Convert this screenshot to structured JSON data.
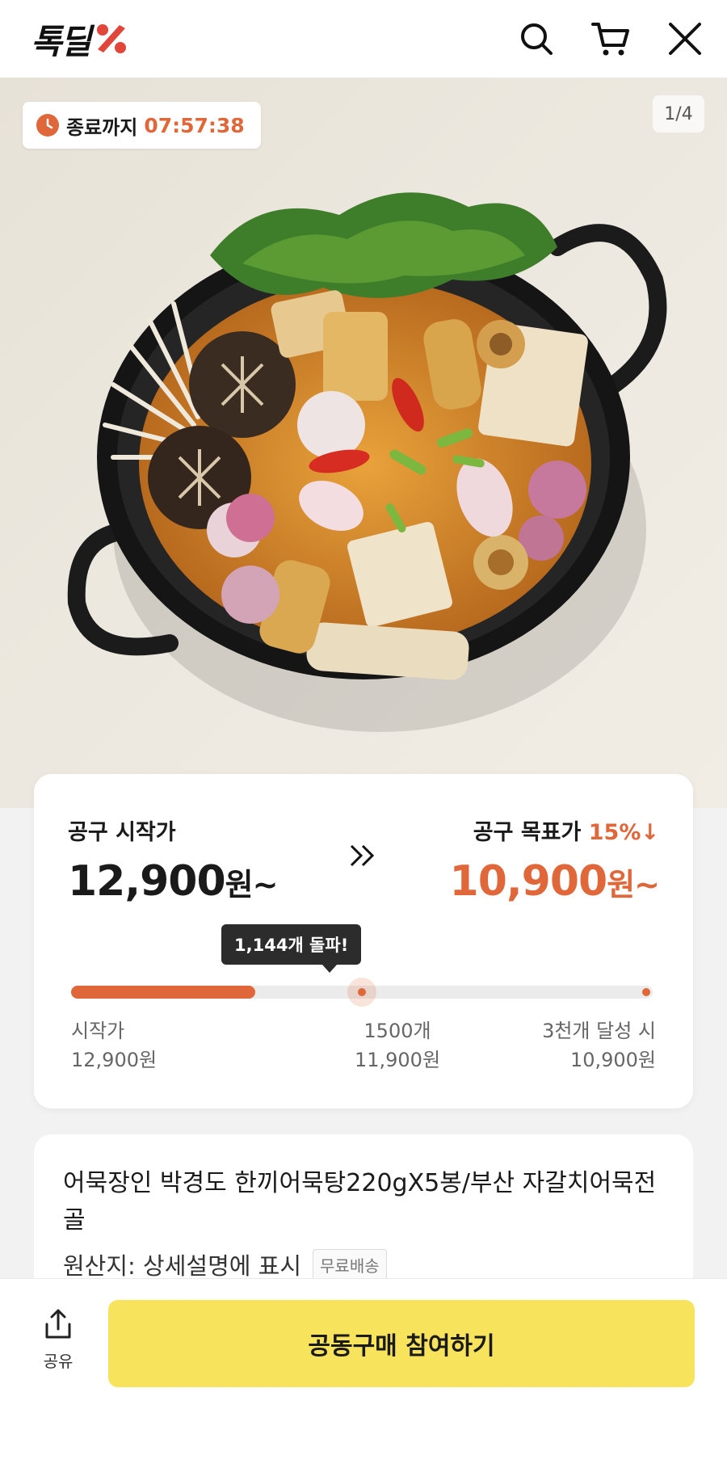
{
  "header": {
    "logo_text": "톡딜",
    "icons": [
      "search-icon",
      "cart-icon",
      "close-icon"
    ]
  },
  "hero": {
    "timer_label": "종료까지",
    "timer_value": "07:57:38",
    "page_counter": "1/4"
  },
  "price": {
    "start_label": "공구 시작가",
    "start_price": "12,900",
    "start_suffix": "원~",
    "target_label": "공구 목표가",
    "target_discount": "15%↓",
    "target_price": "10,900",
    "target_suffix": "원~",
    "progress_tooltip": "1,144개 돌파!",
    "progress_current": 1144,
    "progress_goal": 3000,
    "milestones": [
      {
        "label": "시작가",
        "price": "12,900원"
      },
      {
        "label": "1500개",
        "price": "11,900원"
      },
      {
        "label": "3천개 달성 시",
        "price": "10,900원"
      }
    ]
  },
  "product": {
    "title": "어묵장인 박경도 한끼어묵탕220gX5봉/부산 자갈치어묵전골",
    "origin": "원산지: 상세설명에 표시",
    "shipping_badge": "무료배송"
  },
  "bottom": {
    "share_label": "공유",
    "join_label": "공동구매 참여하기"
  },
  "colors": {
    "accent": "#e0673a",
    "button": "#f7e35c"
  }
}
